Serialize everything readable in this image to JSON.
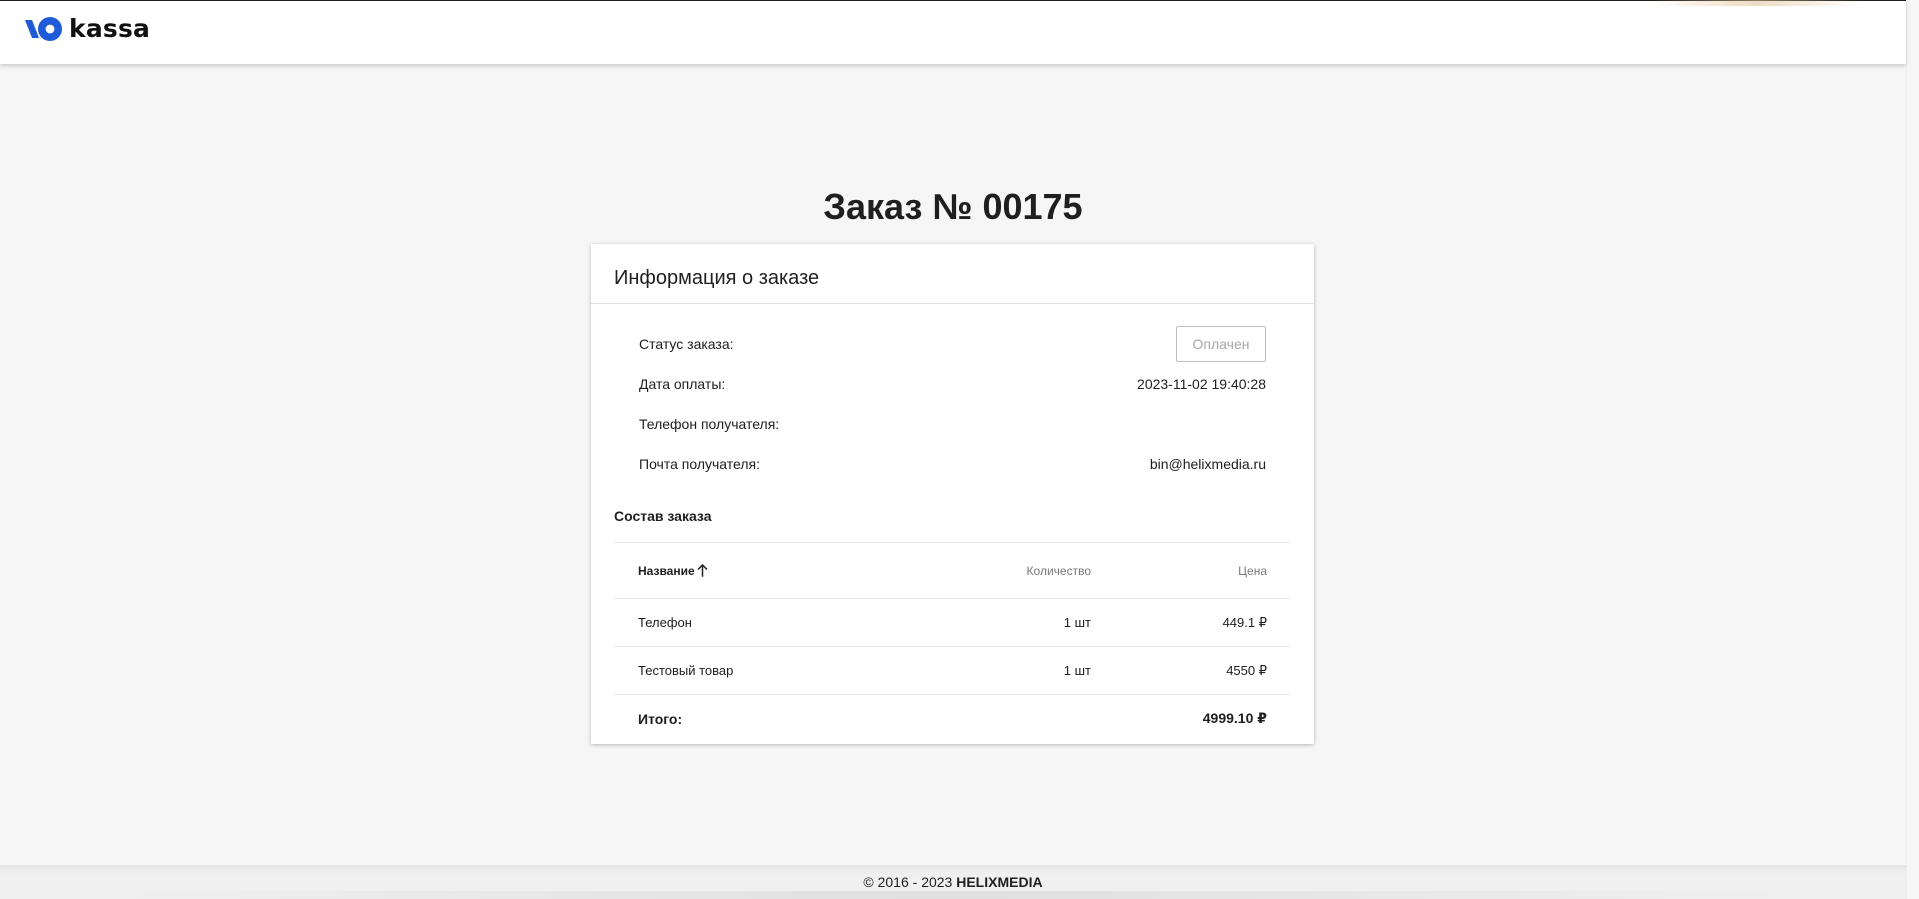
{
  "app": {
    "logo_text": "kassa",
    "brand_color": "#1f5bd8"
  },
  "order": {
    "title": "Заказ № 00175",
    "card_title": "Информация о заказе",
    "status_label": "Статус заказа:",
    "status_value": "Оплачен",
    "payment_date_label": "Дата оплаты:",
    "payment_date_value": "2023-11-02 19:40:28",
    "phone_label": "Телефон получателя:",
    "phone_value": "",
    "email_label": "Почта получателя:",
    "email_value": "bin@helixmedia.ru",
    "items_title": "Состав заказа"
  },
  "table": {
    "headers": {
      "name": "Название",
      "quantity": "Количество",
      "price": "Цена"
    },
    "sort_icon": "arrow-up-icon",
    "rows": [
      {
        "name": "Телефон",
        "quantity": "1 шт",
        "price": "449.1 ₽"
      },
      {
        "name": "Тестовый товар",
        "quantity": "1 шт",
        "price": "4550 ₽"
      }
    ],
    "total_label": "Итого:",
    "total_value": "4999.10 ₽"
  },
  "footer": {
    "copyright": "© 2016 - 2023",
    "company": "HELIXMEDIA"
  }
}
